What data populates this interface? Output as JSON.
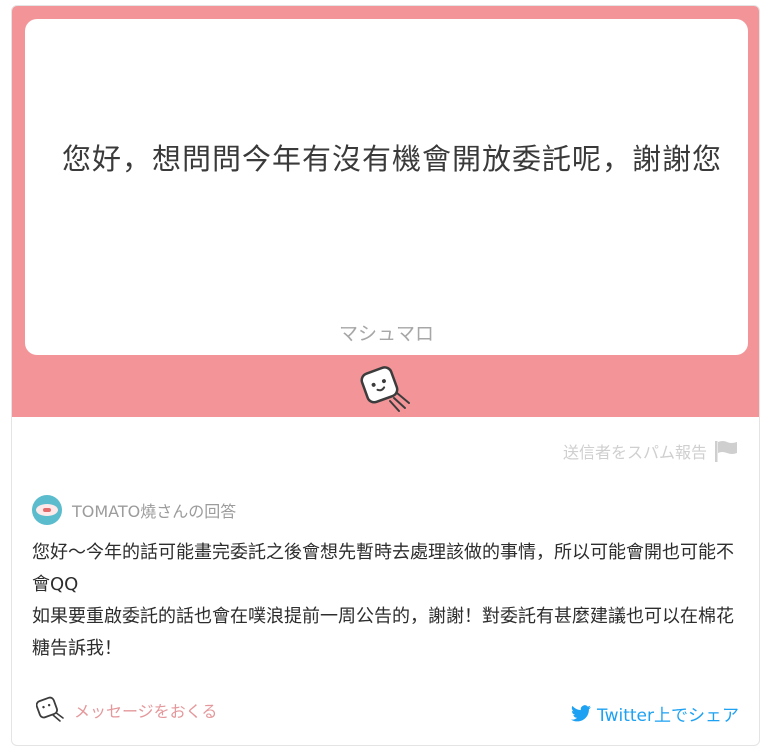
{
  "question": {
    "text": "您好，想問問今年有沒有機會開放委託呢，謝謝您",
    "brand": "マシュマロ"
  },
  "report": {
    "label": "送信者をスパム報告"
  },
  "answer": {
    "author": "TOMATO燒さんの回答",
    "lines": [
      "您好～今年的話可能畫完委託之後會想先暫時去處理該做的事情，所以可能會開也可能不會QQ",
      "如果要重啟委託的話也會在噗浪提前一周公告的，謝謝！對委託有甚麼建議也可以在棉花糖告訴我！"
    ]
  },
  "footer": {
    "send_message": "メッセージをおくる",
    "share": "Twitter上でシェア"
  },
  "colors": {
    "pink": "#f29498",
    "twitter": "#1da1f2",
    "avatar": "#5bbccd"
  }
}
